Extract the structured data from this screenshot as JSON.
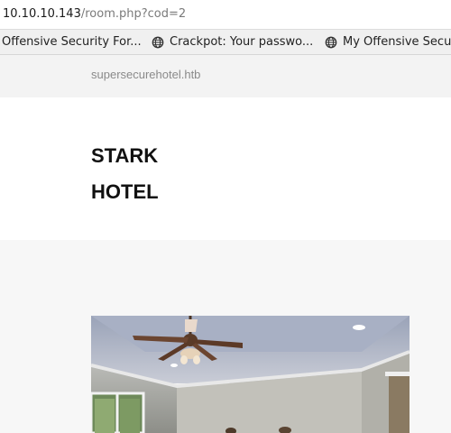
{
  "browser": {
    "url_host": "10.10.10.143",
    "url_path": "/room.php?cod=2",
    "bookmarks": [
      {
        "label": "Offensive Security For..."
      },
      {
        "label": "Crackpot: Your passwo..."
      },
      {
        "label": "My Offensive Secu"
      }
    ]
  },
  "site": {
    "domain": "supersecurehotel.htb",
    "logo_line1": "STARK",
    "logo_line2": "HOTEL"
  },
  "room": {
    "image_icon": "room-photo"
  }
}
